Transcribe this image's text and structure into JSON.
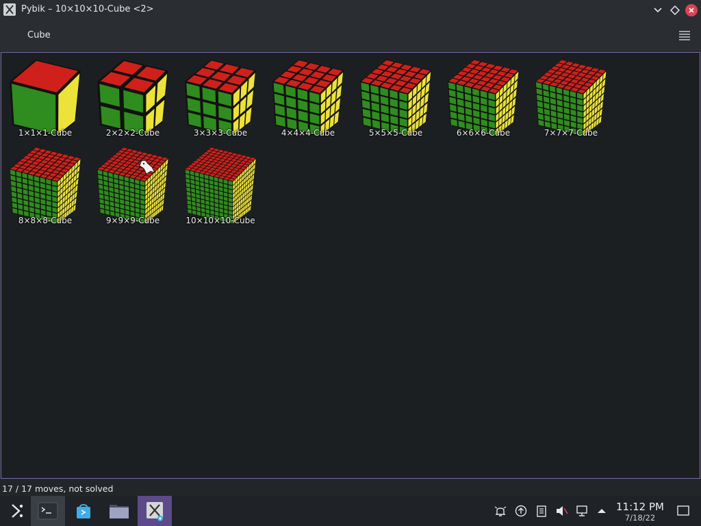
{
  "window": {
    "title": "Pybik – 10×10×10-Cube <2>",
    "buttons": [
      "chevron-down-icon",
      "diamond-icon",
      "close-icon"
    ]
  },
  "toolbar": {
    "menu_label": "Cube",
    "menu_icon": "hamburger-icon"
  },
  "cubes": [
    {
      "label": "1×1×1-Cube",
      "n": 1
    },
    {
      "label": "2×2×2-Cube",
      "n": 2
    },
    {
      "label": "3×3×3-Cube",
      "n": 3
    },
    {
      "label": "4×4×4-Cube",
      "n": 4
    },
    {
      "label": "5×5×5-Cube",
      "n": 5
    },
    {
      "label": "6×6×6-Cube",
      "n": 6
    },
    {
      "label": "7×7×7-Cube",
      "n": 7
    },
    {
      "label": "8×8×8-Cube",
      "n": 8
    },
    {
      "label": "9×9×9-Cube",
      "n": 9
    },
    {
      "label": "10×10×10-Cube",
      "n": 10
    }
  ],
  "colors": {
    "top": "#d0201b",
    "front": "#2f8c1e",
    "right": "#ece23a",
    "accent": "#7a6aa6",
    "close": "#da4453"
  },
  "status": {
    "text": "17 / 17 moves, not solved"
  },
  "taskbar": {
    "apps": [
      "launcher-icon",
      "terminal-icon",
      "discover-icon",
      "file-manager-icon",
      "pybik-icon"
    ],
    "tray": [
      "notifications-icon",
      "updates-icon",
      "clipboard-icon",
      "volume-muted-icon",
      "network-icon",
      "expand-tray-icon"
    ],
    "time": "11:12 PM",
    "date": "7/18/22"
  }
}
